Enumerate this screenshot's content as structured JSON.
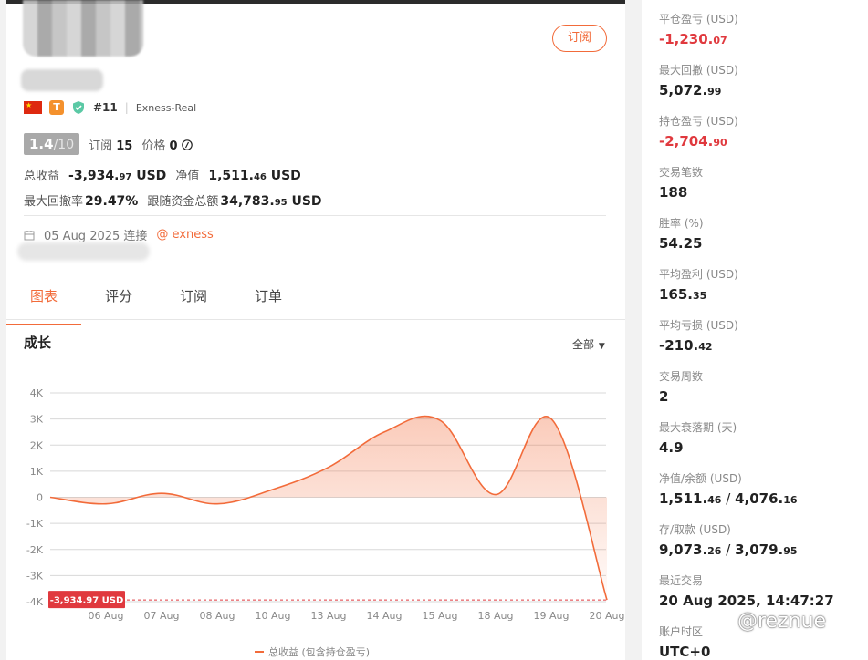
{
  "profile": {
    "subscribe_label": "订阅",
    "rank": "#11",
    "broker": "Exness-Real",
    "score": "1.4",
    "score_den": "/10",
    "subs_label": "订阅",
    "subs_count": "15",
    "price_label": "价格",
    "price_value": "0",
    "total_profit_label": "总收益",
    "total_profit_int": "-3,934.",
    "total_profit_dec": "97",
    "total_profit_unit": "USD",
    "equity_label": "净值",
    "equity_int": "1,511.",
    "equity_dec": "46",
    "equity_unit": "USD",
    "max_dd_label": "最大回撤率",
    "max_dd": "29.47%",
    "follow_funds_label": "跟随资金总额",
    "follow_funds_int": "34,783.",
    "follow_funds_dec": "95",
    "follow_funds_unit": "USD",
    "connected_date": "05 Aug 2025 连接",
    "connected_broker": "@ exness"
  },
  "tabs": [
    "图表",
    "评分",
    "订阅",
    "订单"
  ],
  "chart_head": {
    "title": "成长",
    "range": "全部"
  },
  "chart_data": {
    "type": "area",
    "ylabel": "",
    "ylim": [
      -4000,
      4000
    ],
    "y_ticks": [
      "4K",
      "3K",
      "2K",
      "1K",
      "0",
      "-1K",
      "-2K",
      "-3K",
      "-4K"
    ],
    "x_ticks": [
      "06 Aug",
      "07 Aug",
      "08 Aug",
      "10 Aug",
      "13 Aug",
      "14 Aug",
      "15 Aug",
      "18 Aug",
      "19 Aug",
      "20 Aug"
    ],
    "series": [
      {
        "name": "总收益 (包含持仓盈亏)",
        "color": "#f26b3a",
        "x": [
          "05 Aug",
          "06 Aug",
          "07 Aug",
          "08 Aug",
          "10 Aug",
          "13 Aug",
          "14 Aug",
          "15 Aug",
          "18 Aug",
          "19 Aug",
          "20 Aug"
        ],
        "values": [
          0,
          -250,
          150,
          -250,
          300,
          1150,
          2500,
          2950,
          100,
          3000,
          -3934.97
        ]
      }
    ],
    "last_value_label": "-3,934.97 USD",
    "grid": true,
    "legend": "bottom"
  },
  "stats": [
    {
      "label": "平仓盈亏 (USD)",
      "int": "-1,230.",
      "dec": "07",
      "neg": true
    },
    {
      "label": "最大回撤 (USD)",
      "int": "5,072.",
      "dec": "99",
      "neg": false
    },
    {
      "label": "持仓盈亏 (USD)",
      "int": "-2,704.",
      "dec": "90",
      "neg": true
    },
    {
      "label": "交易笔数",
      "int": "188",
      "dec": "",
      "neg": false
    },
    {
      "label": "胜率 (%)",
      "int": "54.25",
      "dec": "",
      "neg": false
    },
    {
      "label": "平均盈利 (USD)",
      "int": "165.",
      "dec": "35",
      "neg": false
    },
    {
      "label": "平均亏损 (USD)",
      "int": "-210.",
      "dec": "42",
      "neg": false
    },
    {
      "label": "交易周数",
      "int": "2",
      "dec": "",
      "neg": false
    },
    {
      "label": "最大衰落期 (天)",
      "int": "4.9",
      "dec": "",
      "neg": false
    },
    {
      "label": "净值/余额 (USD)",
      "int": "1,511.",
      "dec": "46",
      "int2": "4,076.",
      "dec2": "16",
      "neg": false
    },
    {
      "label": "存/取款 (USD)",
      "int": "9,073.",
      "dec": "26",
      "int2": "3,079.",
      "dec2": "95",
      "neg": false
    },
    {
      "label": "最近交易",
      "int": "20 Aug 2025, 14:47:27",
      "dec": "",
      "neg": false
    },
    {
      "label": "账户时区",
      "int": "UTC+0",
      "dec": "",
      "neg": false
    }
  ],
  "watermark": "@reznue"
}
